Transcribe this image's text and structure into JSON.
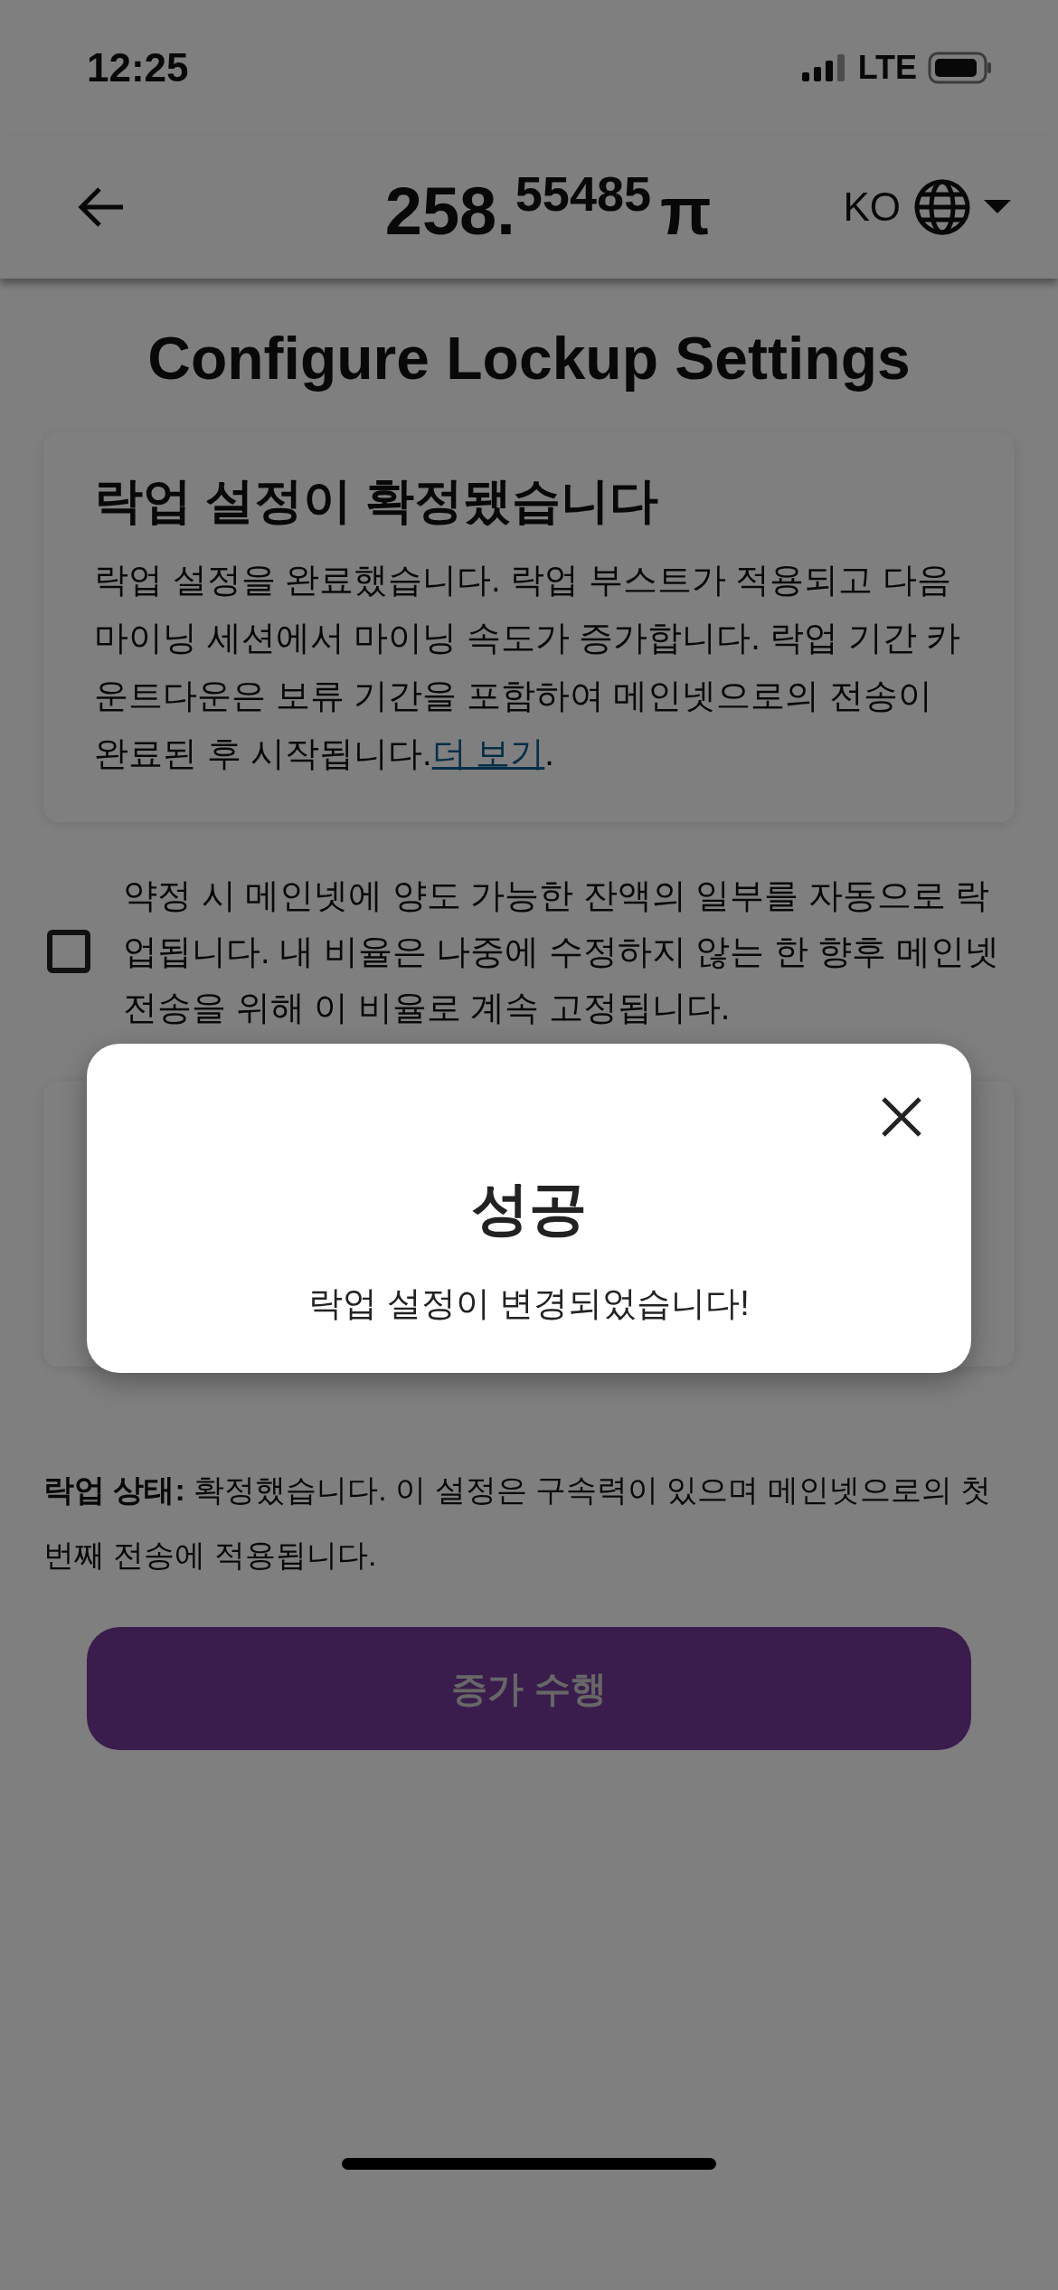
{
  "status_bar": {
    "time": "12:25",
    "network": "LTE"
  },
  "header": {
    "balance_whole": "258.",
    "balance_fraction": "55485",
    "currency": "π",
    "language": "KO"
  },
  "page_title": "Configure Lockup Settings",
  "notice_card": {
    "title": "락업 설정이 확정됐습니다",
    "body": "락업 설정을 완료했습니다. 락업 부스트가 적용되고 다음 마이닝 세션에서 마이닝 속도가 증가합니다. 락업 기간 카운트다운은 보류 기간을 포함하여 메인넷으로의 전송이 완료된 후 시작됩니다.",
    "link": "더 보기",
    "after_link": "."
  },
  "auto_lockup": {
    "checked": false,
    "label": "약정 시 메인넷에 양도 가능한 잔액의 일부를 자동으로 락업됩니다. 내 비율은 나중에 수정하지 않는 한 향후 메인넷 전송을 위해 이 비율로 계속 고정됩니다."
  },
  "lockup_status": "**락업 상태:** 확정했습니다. 이 설정은 구속력이 있으며 메인넷으로의 첫 번째 전송에 적용됩니다.",
  "action_button": {
    "label": "증가 수행",
    "disabled": true
  },
  "dialog": {
    "title": "성공",
    "message": "락업 설정이 변경되었습니다!"
  }
}
